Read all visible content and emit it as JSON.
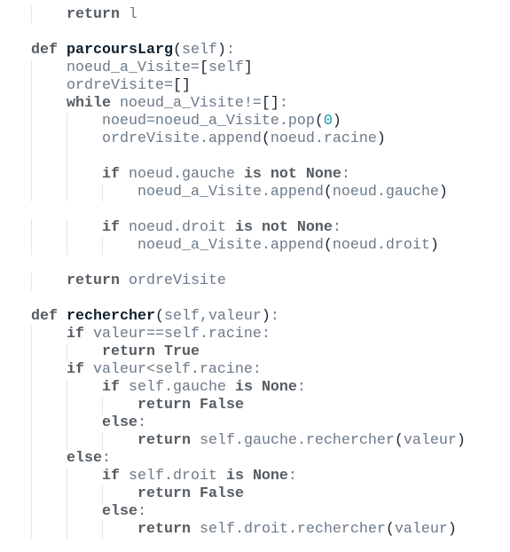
{
  "code": {
    "lines": [
      {
        "indent": 1,
        "tokens": [
          [
            "k",
            "return"
          ],
          [
            "n",
            " l"
          ]
        ]
      },
      {
        "indent": 0,
        "tokens": []
      },
      {
        "indent": 0,
        "tokens": [
          [
            "k",
            "def"
          ],
          [
            "n",
            " "
          ],
          [
            "f",
            "parcoursLarg"
          ],
          [
            "p",
            "("
          ],
          [
            "n",
            "self"
          ],
          [
            "p",
            ")"
          ],
          [
            "n",
            ":"
          ]
        ]
      },
      {
        "indent": 1,
        "tokens": [
          [
            "n",
            "noeud_a_Visite="
          ],
          [
            "p",
            "["
          ],
          [
            "n",
            "self"
          ],
          [
            "p",
            "]"
          ]
        ]
      },
      {
        "indent": 1,
        "tokens": [
          [
            "n",
            "ordreVisite="
          ],
          [
            "p",
            "[]"
          ]
        ]
      },
      {
        "indent": 1,
        "tokens": [
          [
            "k",
            "while"
          ],
          [
            "n",
            " noeud_a_Visite!="
          ],
          [
            "p",
            "[]"
          ],
          [
            "n",
            ":"
          ]
        ]
      },
      {
        "indent": 2,
        "tokens": [
          [
            "n",
            "noeud=noeud_a_Visite.pop"
          ],
          [
            "p",
            "("
          ],
          [
            "num",
            "0"
          ],
          [
            "p",
            ")"
          ]
        ]
      },
      {
        "indent": 2,
        "tokens": [
          [
            "n",
            "ordreVisite.append"
          ],
          [
            "p",
            "("
          ],
          [
            "n",
            "noeud.racine"
          ],
          [
            "p",
            ")"
          ]
        ]
      },
      {
        "indent": 0,
        "guides": 2,
        "tokens": []
      },
      {
        "indent": 2,
        "tokens": [
          [
            "k",
            "if"
          ],
          [
            "n",
            " noeud.gauche "
          ],
          [
            "k",
            "is not None"
          ],
          [
            "n",
            ":"
          ]
        ]
      },
      {
        "indent": 3,
        "tokens": [
          [
            "n",
            "noeud_a_Visite.append"
          ],
          [
            "p",
            "("
          ],
          [
            "n",
            "noeud.gauche"
          ],
          [
            "p",
            ")"
          ]
        ]
      },
      {
        "indent": 0,
        "tokens": []
      },
      {
        "indent": 2,
        "tokens": [
          [
            "k",
            "if"
          ],
          [
            "n",
            " noeud.droit "
          ],
          [
            "k",
            "is not None"
          ],
          [
            "n",
            ":"
          ]
        ]
      },
      {
        "indent": 3,
        "tokens": [
          [
            "n",
            "noeud_a_Visite.append"
          ],
          [
            "p",
            "("
          ],
          [
            "n",
            "noeud.droit"
          ],
          [
            "p",
            ")"
          ]
        ]
      },
      {
        "indent": 0,
        "tokens": []
      },
      {
        "indent": 1,
        "tokens": [
          [
            "k",
            "return"
          ],
          [
            "n",
            " ordreVisite"
          ]
        ]
      },
      {
        "indent": 0,
        "tokens": []
      },
      {
        "indent": 0,
        "tokens": [
          [
            "k",
            "def"
          ],
          [
            "n",
            " "
          ],
          [
            "f",
            "rechercher"
          ],
          [
            "p",
            "("
          ],
          [
            "n",
            "self,valeur"
          ],
          [
            "p",
            ")"
          ],
          [
            "n",
            ":"
          ]
        ]
      },
      {
        "indent": 1,
        "tokens": [
          [
            "k",
            "if"
          ],
          [
            "n",
            " valeur==self.racine:"
          ]
        ]
      },
      {
        "indent": 2,
        "tokens": [
          [
            "k",
            "return True"
          ]
        ]
      },
      {
        "indent": 1,
        "tokens": [
          [
            "k",
            "if"
          ],
          [
            "n",
            " valeur<self.racine:"
          ]
        ]
      },
      {
        "indent": 2,
        "tokens": [
          [
            "k",
            "if"
          ],
          [
            "n",
            " self.gauche "
          ],
          [
            "k",
            "is None"
          ],
          [
            "n",
            ":"
          ]
        ]
      },
      {
        "indent": 3,
        "tokens": [
          [
            "k",
            "return False"
          ]
        ]
      },
      {
        "indent": 2,
        "tokens": [
          [
            "k",
            "else"
          ],
          [
            "n",
            ":"
          ]
        ]
      },
      {
        "indent": 3,
        "tokens": [
          [
            "k",
            "return"
          ],
          [
            "n",
            " self.gauche.rechercher"
          ],
          [
            "p",
            "("
          ],
          [
            "n",
            "valeur"
          ],
          [
            "p",
            ")"
          ]
        ]
      },
      {
        "indent": 1,
        "tokens": [
          [
            "k",
            "else"
          ],
          [
            "n",
            ":"
          ]
        ]
      },
      {
        "indent": 2,
        "tokens": [
          [
            "k",
            "if"
          ],
          [
            "n",
            " self.droit "
          ],
          [
            "k",
            "is None"
          ],
          [
            "n",
            ":"
          ]
        ]
      },
      {
        "indent": 3,
        "tokens": [
          [
            "k",
            "return False"
          ]
        ]
      },
      {
        "indent": 2,
        "tokens": [
          [
            "k",
            "else"
          ],
          [
            "n",
            ":"
          ]
        ]
      },
      {
        "indent": 3,
        "tokens": [
          [
            "k",
            "return"
          ],
          [
            "n",
            " self.droit.rechercher"
          ],
          [
            "p",
            "("
          ],
          [
            "n",
            "valeur"
          ],
          [
            "p",
            ")"
          ]
        ]
      }
    ]
  }
}
